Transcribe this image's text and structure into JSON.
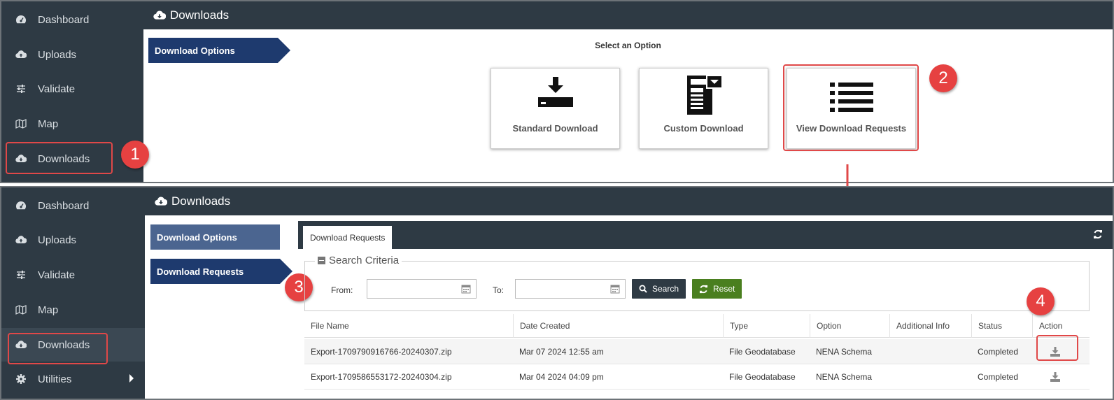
{
  "sidebar": {
    "items": [
      {
        "label": "Dashboard",
        "icon": "dashboard-icon"
      },
      {
        "label": "Uploads",
        "icon": "cloud-upload-icon"
      },
      {
        "label": "Validate",
        "icon": "sliders-icon"
      },
      {
        "label": "Map",
        "icon": "map-icon"
      },
      {
        "label": "Downloads",
        "icon": "cloud-download-icon"
      },
      {
        "label": "Utilities",
        "icon": "gear-icon"
      }
    ]
  },
  "header": {
    "title": "Downloads"
  },
  "panel1": {
    "nav": {
      "download_options": "Download Options"
    },
    "select_title": "Select an Option",
    "options": [
      {
        "label": "Standard Download",
        "icon": "download-tray-icon"
      },
      {
        "label": "Custom Download",
        "icon": "custom-form-icon"
      },
      {
        "label": "View Download Requests",
        "icon": "list-icon"
      }
    ]
  },
  "panel2": {
    "nav": {
      "download_options": "Download Options",
      "download_requests": "Download Requests"
    },
    "tab": "Download Requests",
    "search": {
      "legend": "Search Criteria",
      "from_label": "From:",
      "to_label": "To:",
      "from_value": "",
      "to_value": "",
      "search_button": "Search",
      "reset_button": "Reset"
    },
    "table": {
      "headers": [
        "File Name",
        "Date Created",
        "Type",
        "Option",
        "Additional Info",
        "Status",
        "Action"
      ],
      "rows": [
        {
          "file_name": "Export-1709790916766-20240307.zip",
          "date_created": "Mar 07 2024 12:55 am",
          "type": "File Geodatabase",
          "option": "NENA Schema",
          "additional_info": "",
          "status": "Completed"
        },
        {
          "file_name": "Export-1709586553172-20240304.zip",
          "date_created": "Mar 04 2024 04:09 pm",
          "type": "File Geodatabase",
          "option": "NENA Schema",
          "additional_info": "",
          "status": "Completed"
        }
      ]
    }
  },
  "callouts": [
    "1",
    "2",
    "3",
    "4"
  ],
  "colors": {
    "sidebar_bg": "#2e3a44",
    "nav_active": "#1e3a6e",
    "nav_inactive": "#4b6590",
    "search_button": "#2e3a44",
    "reset_button": "#4a7f1f",
    "highlight": "#e04848"
  }
}
